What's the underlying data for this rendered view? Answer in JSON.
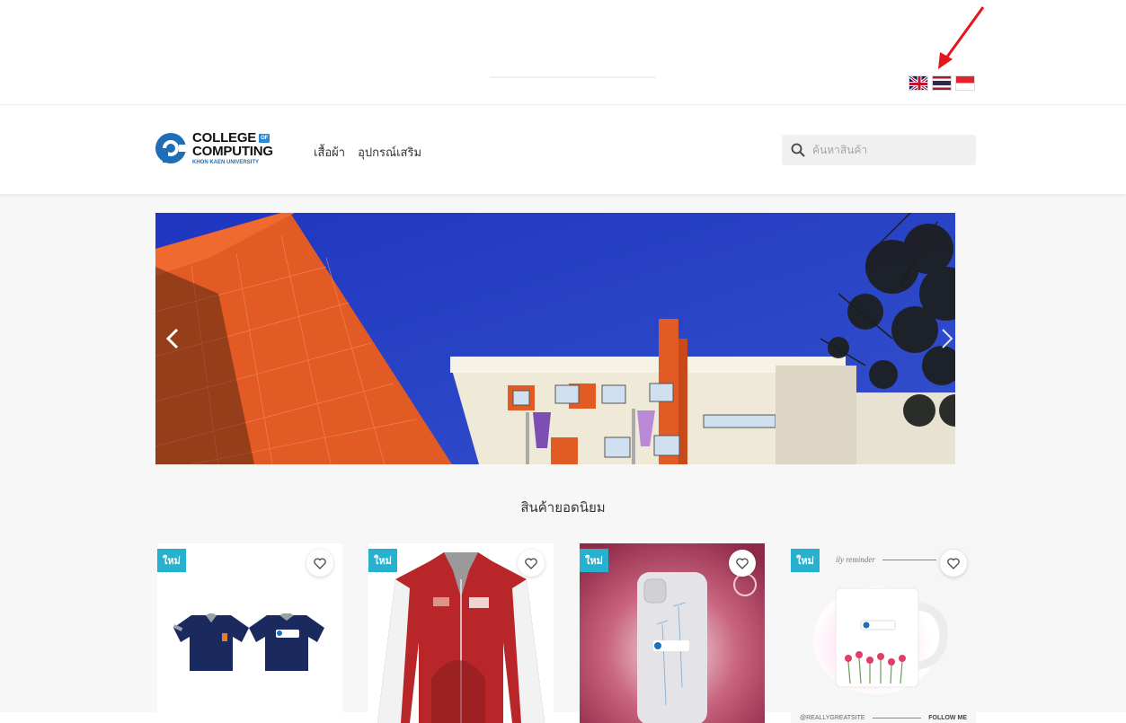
{
  "languages": [
    {
      "name": "English",
      "icon": "uk-flag-icon"
    },
    {
      "name": "Thai",
      "icon": "thai-flag-icon"
    },
    {
      "name": "Indonesian",
      "icon": "indonesia-flag-icon"
    }
  ],
  "header": {
    "logo": {
      "line1": "COLLEGE",
      "of": "OF",
      "line2": "COMPUTING",
      "line3": "KHON KAEN UNIVERSITY"
    },
    "nav": [
      "เสื้อผ้า",
      "อุปกรณ์เสริม"
    ],
    "search_placeholder": "ค้นหาสินค้า"
  },
  "section_title": "สินค้ายอดนิยม",
  "products": [
    {
      "badge": "ใหม่",
      "kind": "polo-shirt"
    },
    {
      "badge": "ใหม่",
      "kind": "jacket"
    },
    {
      "badge": "ใหม่",
      "kind": "phone-case"
    },
    {
      "badge": "ใหม่",
      "kind": "mug",
      "top_text": "ily reminder",
      "bottom_left": "@REALLYGREATSITE",
      "bottom_right": "FOLLOW ME"
    }
  ],
  "colors": {
    "accent": "#27b1cf",
    "banner_sky": "#2339b8",
    "building_orange": "#e25a24"
  }
}
